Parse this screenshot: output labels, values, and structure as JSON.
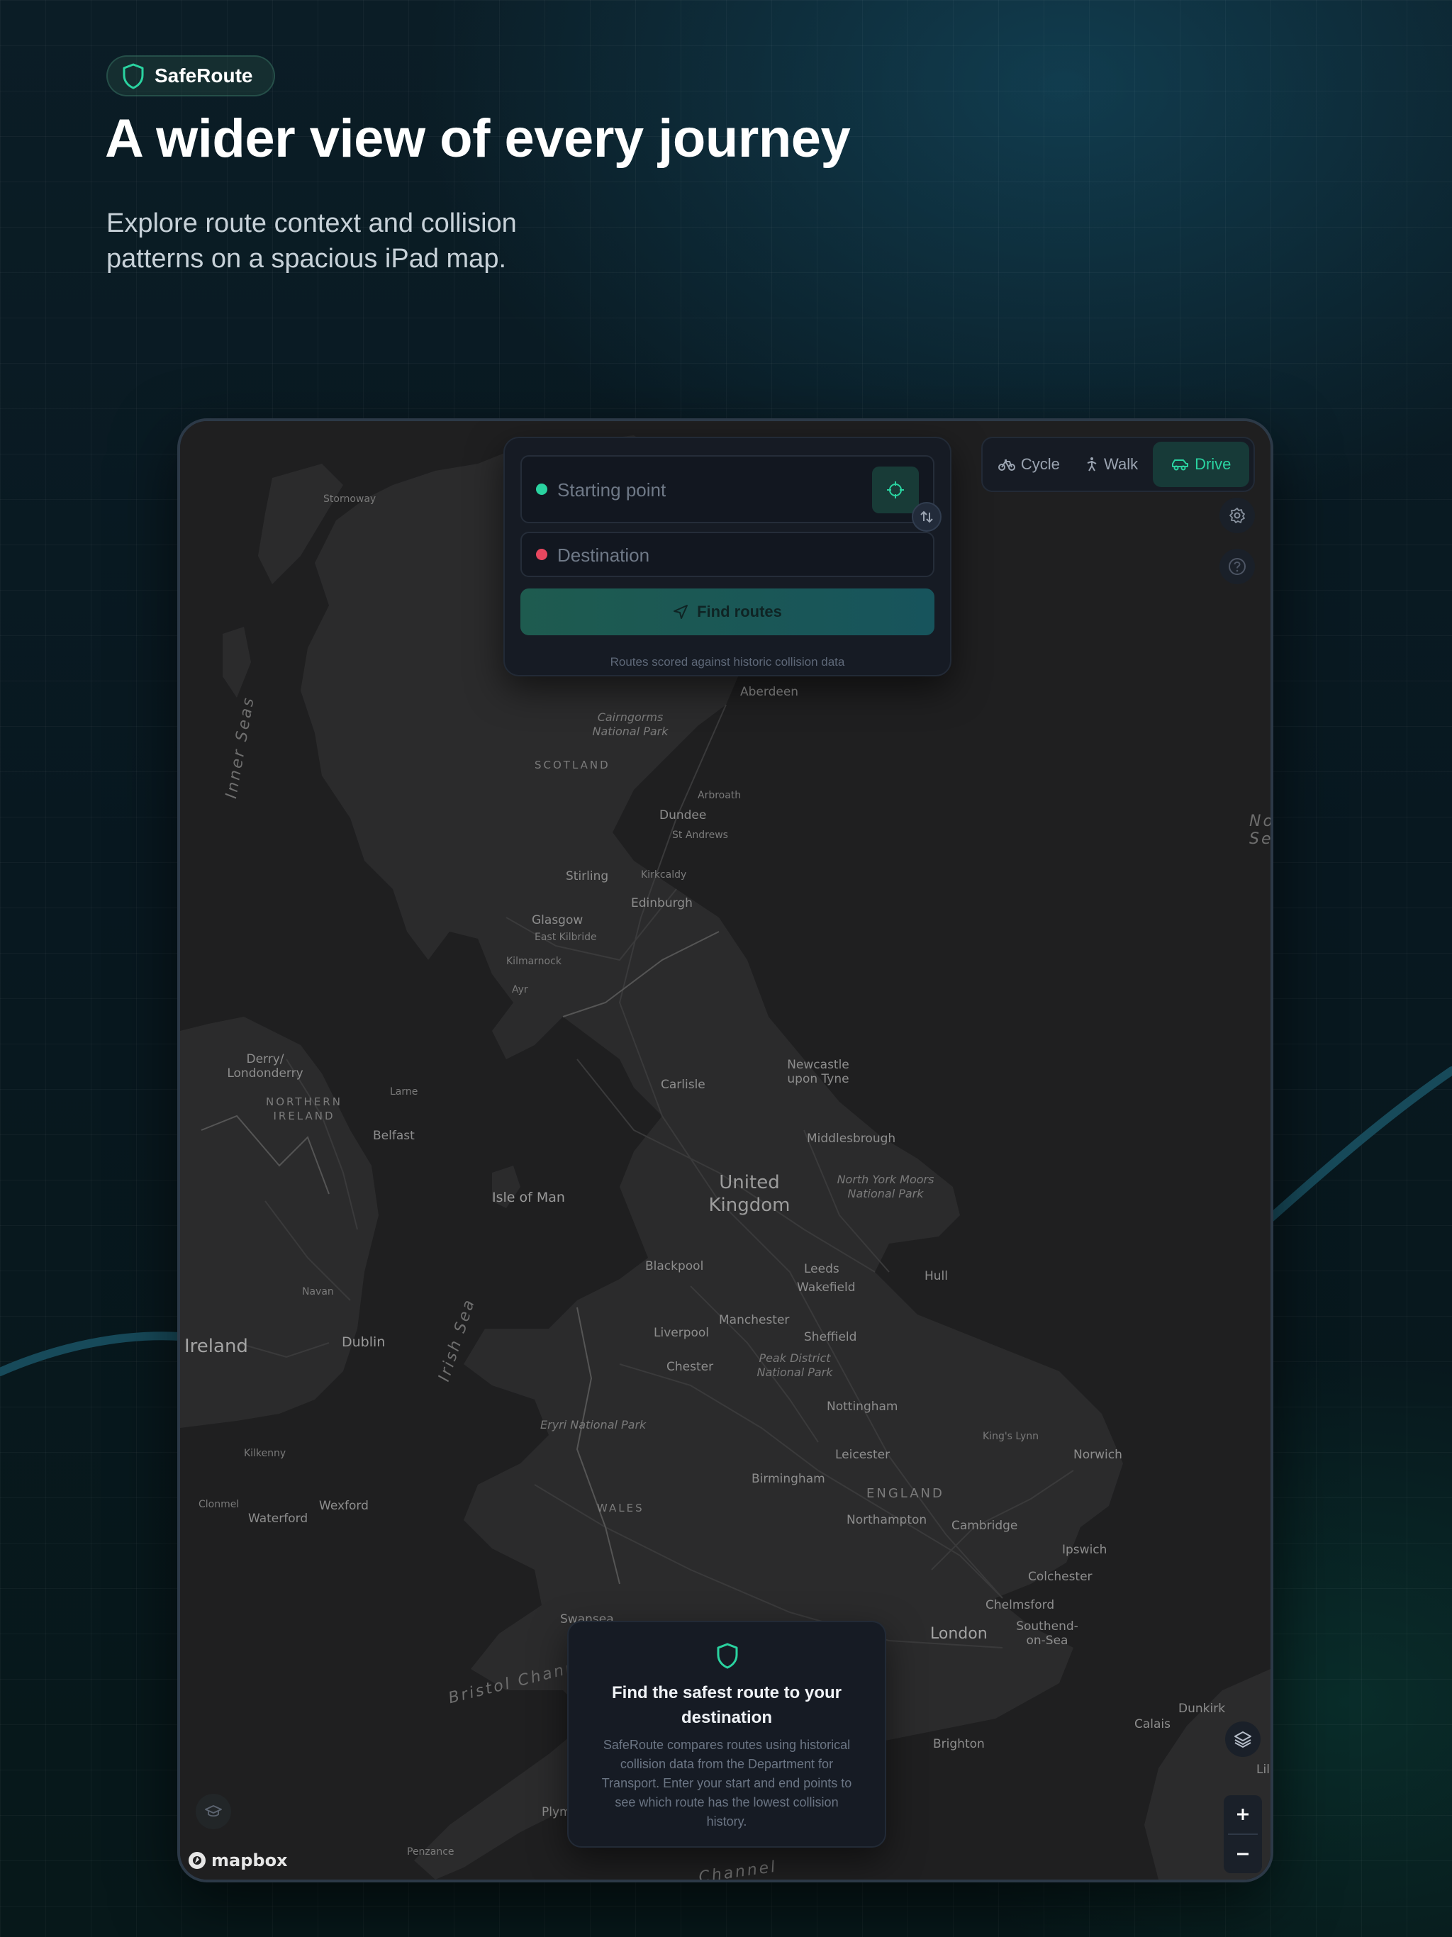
{
  "brand": {
    "name": "SafeRoute"
  },
  "hero": {
    "title": "A wider view of every journey",
    "subtitle": "Explore route context and collision patterns on a spacious iPad map."
  },
  "search": {
    "start_placeholder": "Starting point",
    "destination_placeholder": "Destination",
    "find_label": "Find routes",
    "caption": "Routes scored against historic collision data"
  },
  "modes": [
    {
      "label": "Cycle",
      "icon": "bicycle-icon",
      "active": false
    },
    {
      "label": "Walk",
      "icon": "walking-icon",
      "active": false
    },
    {
      "label": "Drive",
      "icon": "car-icon",
      "active": true
    }
  ],
  "info": {
    "title": "Find the safest route to your destination",
    "body": "SafeRoute compares routes using historical collision data from the Department for Transport. Enter your start and end points to see which route has the lowest collision history."
  },
  "attribution": "mapbox",
  "map": {
    "labels": {
      "stornoway": "Stornoway",
      "aberdeen": "Aberdeen",
      "cairngorms": "Cairngorms National Park",
      "scotland": "SCOTLAND",
      "arbroath": "Arbroath",
      "dundee": "Dundee",
      "standrews": "St Andrews",
      "stirling": "Stirling",
      "kirkcaldy": "Kirkcaldy",
      "edinburgh": "Edinburgh",
      "glasgow": "Glasgow",
      "eastkilbride": "East Kilbride",
      "kilmarnock": "Kilmarnock",
      "ayr": "Ayr",
      "innerseas": "Inner Seas",
      "northsea": "North Sea",
      "derry": "Derry/ Londonderry",
      "nireland": "NORTHERN IRELAND",
      "larne": "Larne",
      "belfast": "Belfast",
      "newcastle": "Newcastle upon Tyne",
      "carlisle": "Carlisle",
      "middlesbrough": "Middlesbrough",
      "nymoors": "North York Moors National Park",
      "uk": "United Kingdom",
      "isleofman": "Isle of Man",
      "blackpool": "Blackpool",
      "leeds": "Leeds",
      "wakefield": "Wakefield",
      "hull": "Hull",
      "navan": "Navan",
      "ireland": "Ireland",
      "dublin": "Dublin",
      "irishsea": "Irish Sea",
      "liverpool": "Liverpool",
      "manchester": "Manchester",
      "sheffield": "Sheffield",
      "chester": "Chester",
      "peakdistrict": "Peak District National Park",
      "nottingham": "Nottingham",
      "eryri": "Eryri National Park",
      "kingslynn": "King's Lynn",
      "norwich": "Norwich",
      "kilkenny": "Kilkenny",
      "leicester": "Leicester",
      "birmingham": "Birmingham",
      "england": "ENGLAND",
      "wales": "WALES",
      "clonmel": "Clonmel",
      "waterford": "Waterford",
      "wexford": "Wexford",
      "northampton": "Northampton",
      "cambridge": "Cambridge",
      "ipswich": "Ipswich",
      "colchester": "Colchester",
      "chelmsford": "Chelmsford",
      "swansea": "Swansea",
      "southend": "Southend-on-Sea",
      "london": "London",
      "bristolchannel": "Bristol Channel",
      "dunkirk": "Dunkirk",
      "calais": "Calais",
      "brighton": "Brighton",
      "plymouth": "Plym",
      "penzance": "Penzance",
      "englishchannel": "Channel",
      "lille": "Lil"
    }
  },
  "colors": {
    "accent": "#2ad3a0",
    "start_dot": "#2ad3a0",
    "destination_dot": "#e8475f",
    "panel": "#161b24",
    "map_land": "#2c2c2c",
    "map_water": "#1f1f20"
  }
}
